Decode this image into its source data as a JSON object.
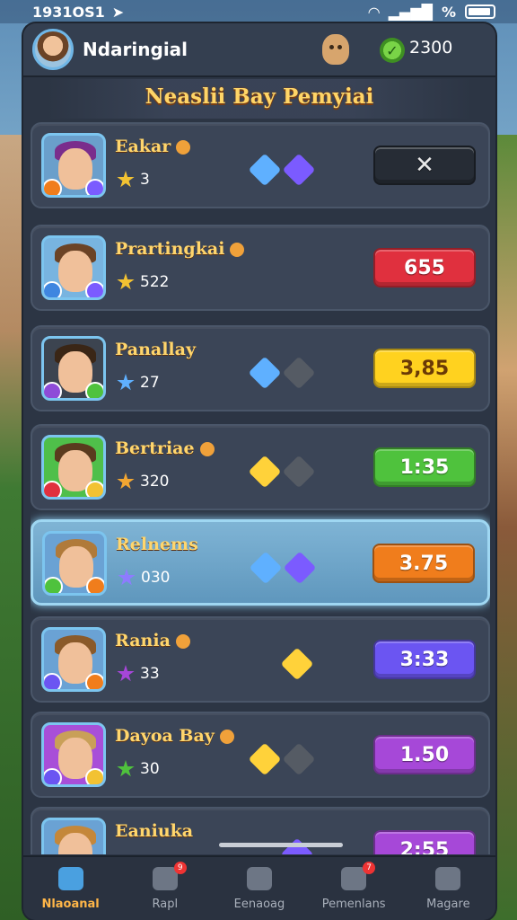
{
  "status_bar": {
    "time": "1931OS1",
    "battery_label": "%"
  },
  "header": {
    "player_name": "Ndaringial",
    "coins": "2300"
  },
  "title": "Neaslii Bay Pemyiai",
  "rows": [
    {
      "name": "Eakar",
      "score": "3",
      "button": "✕",
      "button_color": "#262c35",
      "gems": [
        "#5fb0ff",
        "#7b5bff"
      ],
      "avatar_hair": "#7a2d8c",
      "avatar_bg": "#6a9fcb"
    },
    {
      "name": "Prartingkai",
      "score": "522",
      "button": "655",
      "button_color": "#e0303e",
      "gems": [],
      "avatar_hair": "#6b4326",
      "avatar_bg": "#78b4e0"
    },
    {
      "name": "Panallay",
      "score": "27",
      "button": "3,85",
      "button_color": "#ffd21f",
      "gems": [
        "#5fb0ff",
        "#555b64"
      ],
      "avatar_hair": "#3a2616",
      "avatar_bg": "#3c4450"
    },
    {
      "name": "Bertriae",
      "score": "320",
      "button": "1:35",
      "button_color": "#4fc23d",
      "gems": [
        "#ffd23a",
        "#555b64"
      ],
      "avatar_hair": "#5a3a1e",
      "avatar_bg": "#4fbf4a"
    },
    {
      "name": "Relnems",
      "score": "030",
      "button": "3.75",
      "button_color": "#f07d1c",
      "gems": [
        "#5fb0ff",
        "#7b5bff"
      ],
      "avatar_hair": "#b07a3a",
      "avatar_bg": "#6aa2d4"
    },
    {
      "name": "Rania",
      "score": "33",
      "button": "3:33",
      "button_color": "#6b55f2",
      "gems": [
        "#ffd23a"
      ],
      "avatar_hair": "#8a5a2a",
      "avatar_bg": "#6aa2d4"
    },
    {
      "name": "Dayoa Bay",
      "score": "30",
      "button": "1.50",
      "button_color": "#a648d8",
      "gems": [
        "#ffd23a",
        "#555b64"
      ],
      "avatar_hair": "#c9a058",
      "avatar_bg": "#a84fd8"
    },
    {
      "name": "Eaniuka",
      "score": "",
      "button": "2:55",
      "button_color": "#a648d8",
      "gems": [
        "#7b5bff"
      ],
      "avatar_hair": "#c4873a",
      "avatar_bg": "#6aa2d4"
    }
  ],
  "nav": [
    {
      "label": "Nlaoanal",
      "icon": "home-icon",
      "active": true,
      "badge": ""
    },
    {
      "label": "Rapl",
      "icon": "chat-icon",
      "active": false,
      "badge": "9"
    },
    {
      "label": "Eenaoag",
      "icon": "shop-icon",
      "active": false,
      "badge": ""
    },
    {
      "label": "Pemenlans",
      "icon": "mail-icon",
      "active": false,
      "badge": "7"
    },
    {
      "label": "Magare",
      "icon": "map-icon",
      "active": false,
      "badge": ""
    }
  ]
}
